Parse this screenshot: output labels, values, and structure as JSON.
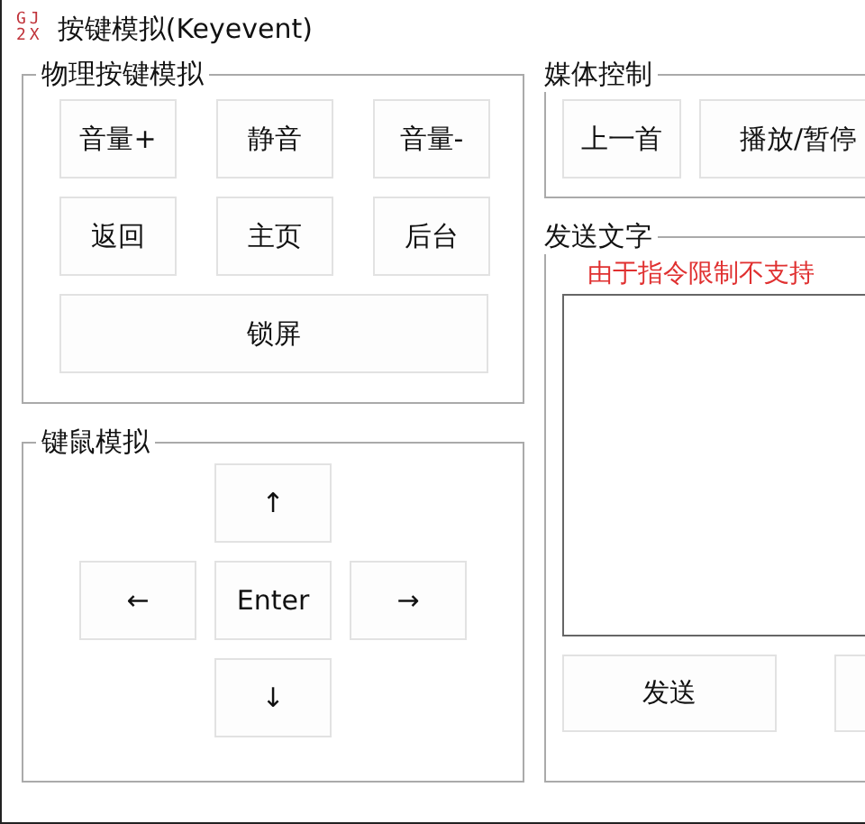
{
  "window": {
    "logo": [
      "GJ",
      "2X"
    ],
    "title": "按键模拟(Keyevent)"
  },
  "physical_keys": {
    "title": "物理按键模拟",
    "buttons": [
      "音量+",
      "静音",
      "音量-",
      "返回",
      "主页",
      "后台"
    ],
    "wide_button": "锁屏"
  },
  "mouse_keys": {
    "title": "键鼠模拟",
    "up": "↑",
    "left": "←",
    "enter": "Enter",
    "right": "→",
    "down": "↓"
  },
  "media": {
    "title": "媒体控制",
    "buttons": [
      "上一首",
      "播放/暂停"
    ]
  },
  "send_text": {
    "title": "发送文字",
    "notice": "由于指令限制不支持",
    "send_button": "发送"
  }
}
